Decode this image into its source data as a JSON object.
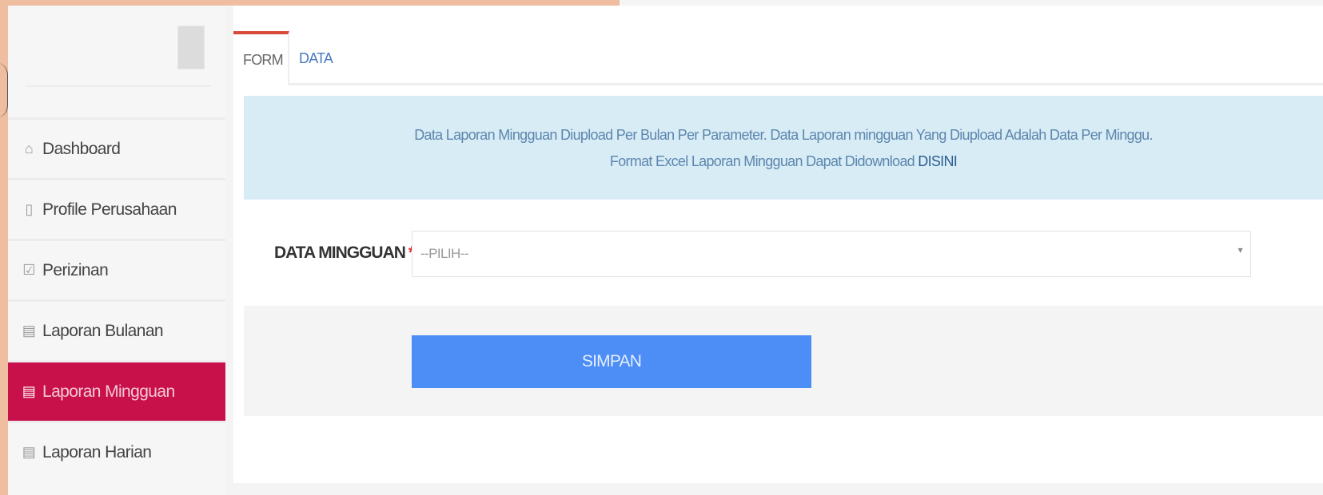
{
  "sidebar": {
    "items": [
      {
        "label": "Dashboard",
        "icon": "dashboard-icon",
        "glyph": "⌂",
        "active": false
      },
      {
        "label": "Profile Perusahaan",
        "icon": "file-icon",
        "glyph": "▯",
        "active": false
      },
      {
        "label": "Perizinan",
        "icon": "check-square-icon",
        "glyph": "☑",
        "active": false
      },
      {
        "label": "Laporan Bulanan",
        "icon": "book-icon",
        "glyph": "▤",
        "active": false
      },
      {
        "label": "Laporan Mingguan",
        "icon": "book-icon",
        "glyph": "▤",
        "active": true
      },
      {
        "label": "Laporan Harian",
        "icon": "book-icon",
        "glyph": "▤",
        "active": false
      }
    ]
  },
  "tabs": [
    {
      "label": "FORM",
      "active": true
    },
    {
      "label": "DATA",
      "active": false
    }
  ],
  "info": {
    "line1": "Data Laporan Mingguan Diupload Per Bulan Per Parameter. Data Laporan mingguan Yang Diupload Adalah Data Per Minggu.",
    "line2_prefix": "Format Excel Laporan Mingguan Dapat Didownload ",
    "line2_link": "DISINI"
  },
  "form": {
    "label": "DATA MINGGUAN",
    "required_mark": "*",
    "select_value": "--PILIH--",
    "caret": "▾"
  },
  "actions": {
    "save_label": "SIMPAN"
  },
  "colors": {
    "accent": "#c8104b",
    "button": "#4c8df6",
    "info_bg": "#d8ecf6",
    "frame": "#efbd9f"
  }
}
